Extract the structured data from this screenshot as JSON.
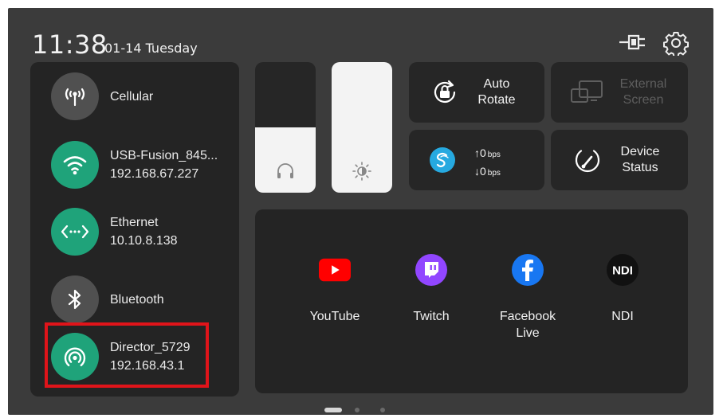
{
  "status": {
    "time": "11:38",
    "date": "01-14 Tuesday"
  },
  "network": {
    "items": [
      {
        "label": "Cellular",
        "sub": "",
        "icon": "cellular-icon"
      },
      {
        "label": "USB-Fusion_845...",
        "sub": "192.168.67.227",
        "icon": "wifi-icon"
      },
      {
        "label": "Ethernet",
        "sub": "10.10.8.138",
        "icon": "ethernet-icon"
      },
      {
        "label": "Bluetooth",
        "sub": "",
        "icon": "bluetooth-icon"
      },
      {
        "label": "Director_5729",
        "sub": "192.168.43.1",
        "icon": "hotspot-icon"
      }
    ]
  },
  "sliders": {
    "volume_level": 0.5,
    "brightness_level": 1.0
  },
  "tiles": {
    "auto_rotate": {
      "line1": "Auto",
      "line2": "Rotate"
    },
    "external_screen": {
      "line1": "External",
      "line2": "Screen"
    },
    "speed": {
      "up": "0",
      "down": "0",
      "unit": "bps"
    },
    "device_status": {
      "line1": "Device",
      "line2": "Status"
    }
  },
  "apps": [
    {
      "line1": "YouTube",
      "line2": "",
      "icon": "youtube-icon",
      "color": "#ff0000"
    },
    {
      "line1": "Twitch",
      "line2": "",
      "icon": "twitch-icon",
      "color": "#9146ff"
    },
    {
      "line1": "Facebook",
      "line2": "Live",
      "icon": "facebook-icon",
      "color": "#1877f2"
    },
    {
      "line1": "NDI",
      "line2": "",
      "icon": "ndi-icon",
      "color": "#111111"
    }
  ],
  "colors": {
    "accent_green": "#1fa37a",
    "highlight_red": "#e0141a",
    "background": "#3b3b3b",
    "panel": "#242424"
  }
}
